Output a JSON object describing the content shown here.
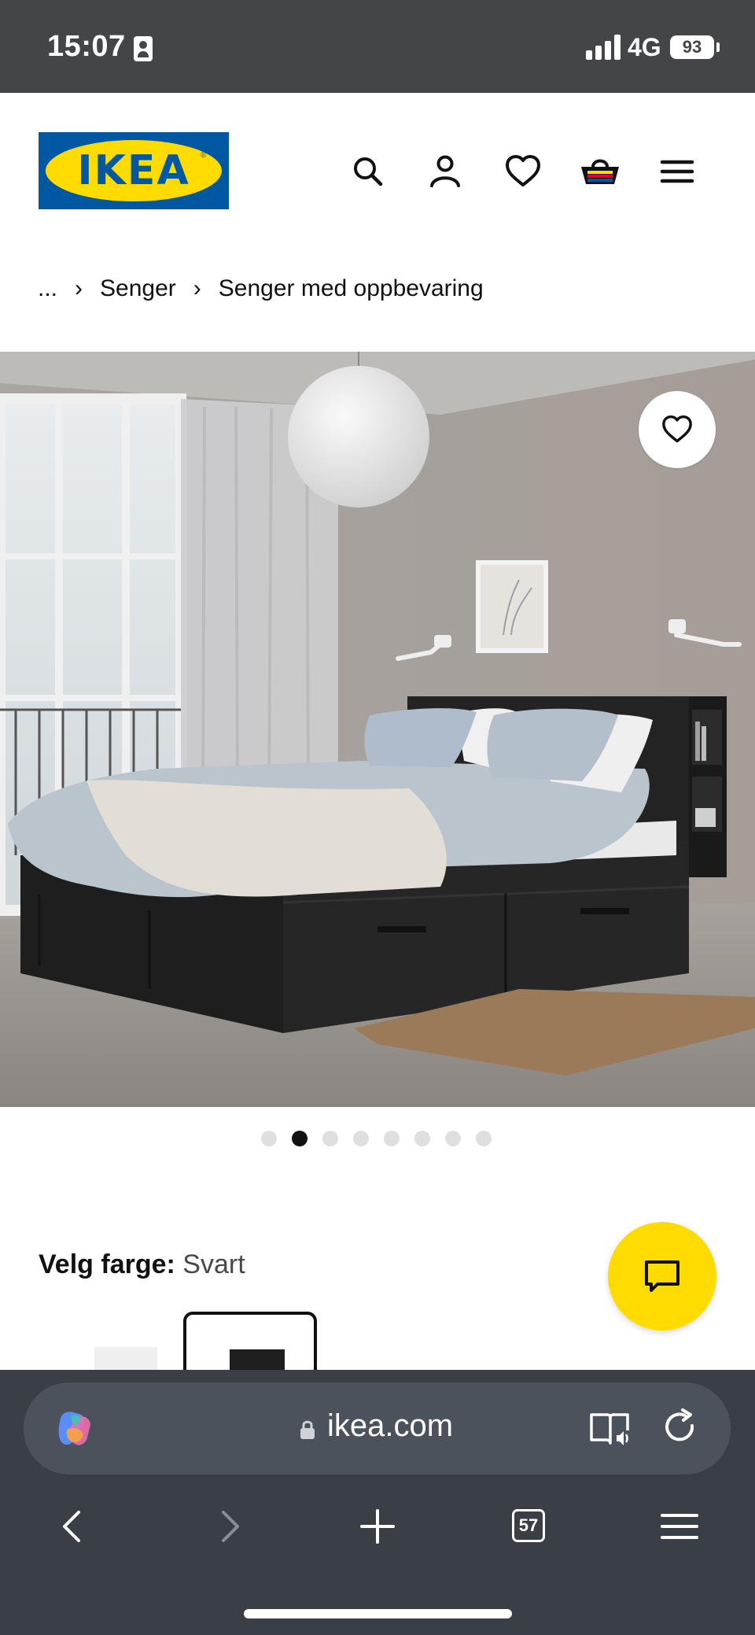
{
  "status_bar": {
    "time": "15:07",
    "network": "4G",
    "battery": "93"
  },
  "header": {
    "logo_text": "IKEA",
    "logo_registered": "®",
    "icons": [
      "search-icon",
      "account-icon",
      "favorites-icon",
      "cart-icon",
      "menu-icon"
    ]
  },
  "breadcrumb": {
    "ellipsis": "...",
    "separator": "›",
    "items": [
      "Senger",
      "Senger med oppbevaring"
    ]
  },
  "gallery": {
    "total": 8,
    "active_index": 1
  },
  "color_select": {
    "label": "Velg farge:",
    "value": "Svart"
  },
  "browser": {
    "url": "ikea.com",
    "tabs_count": "57"
  },
  "colors": {
    "ikea_blue": "#0058a3",
    "ikea_yellow": "#ffdb00",
    "status_bar": "#444546",
    "browser_bar": "#3a3f46"
  }
}
